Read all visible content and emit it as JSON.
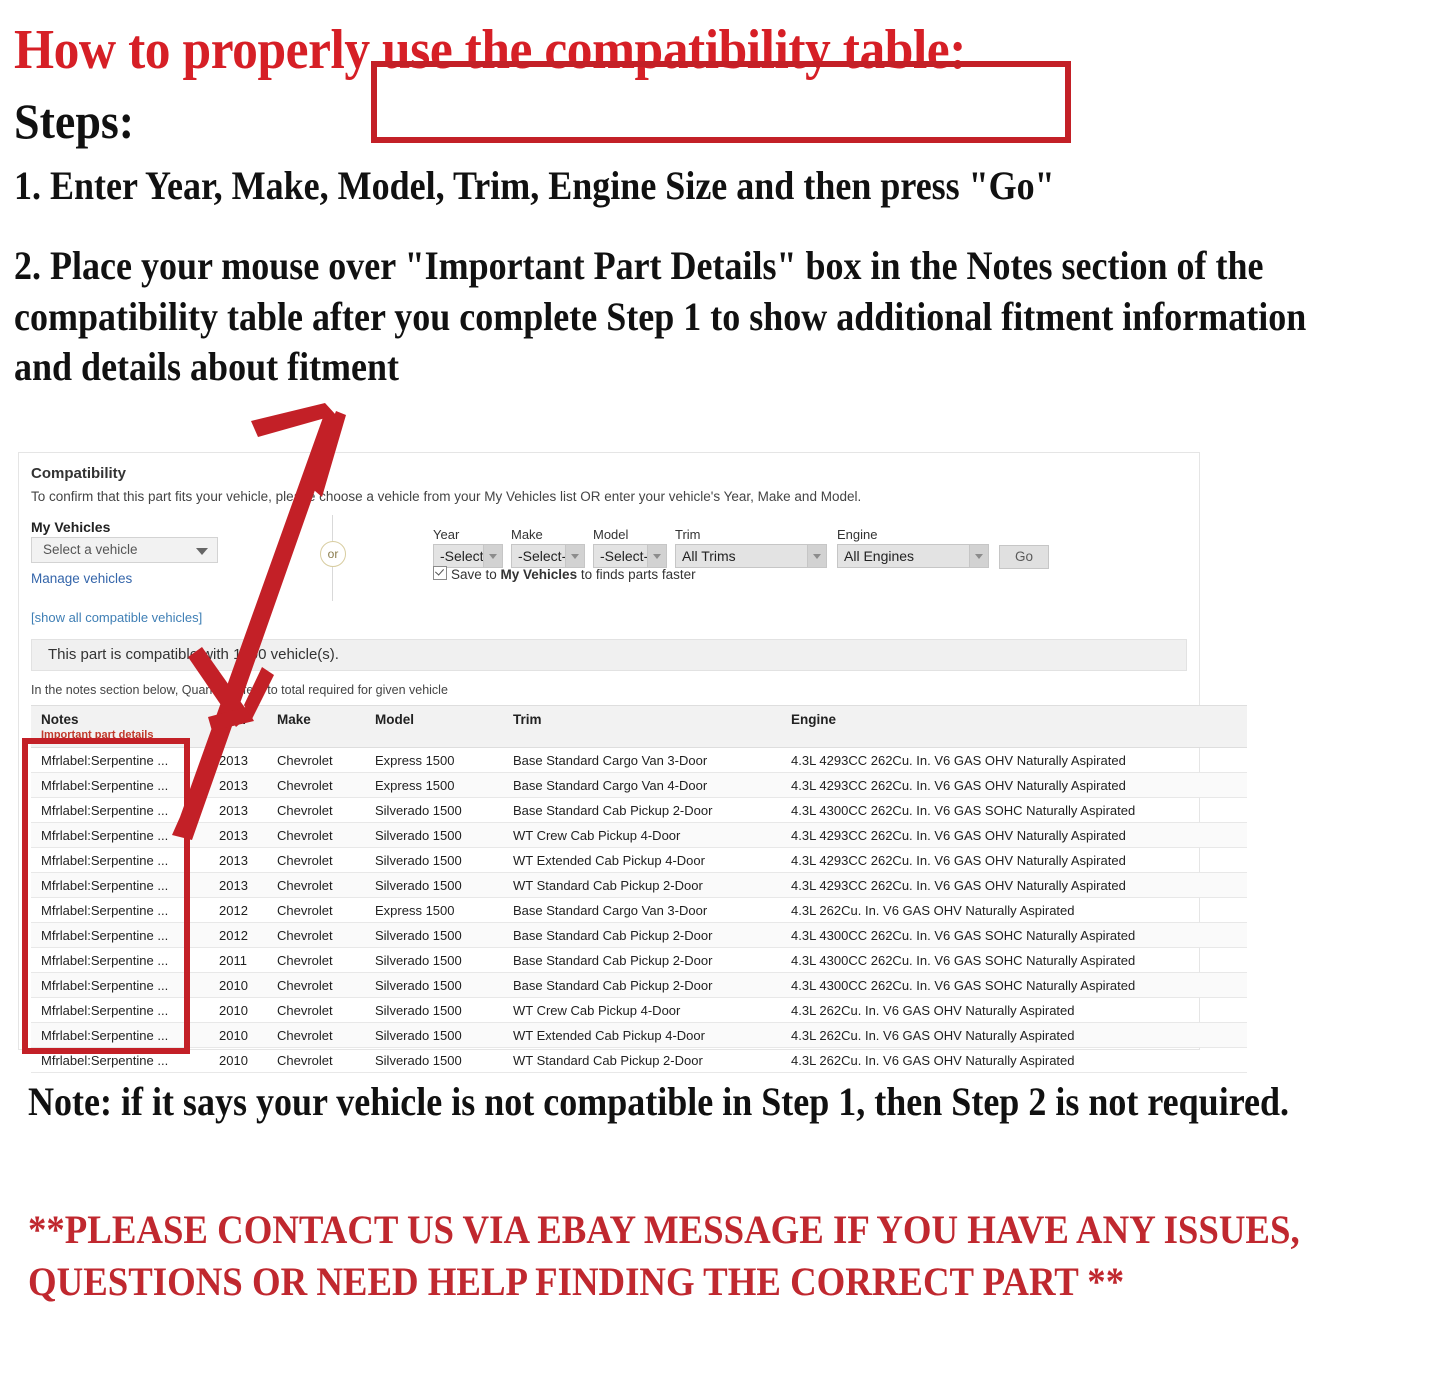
{
  "instructions": {
    "headline": "How to properly use the compatibility table:",
    "steps_label": "Steps:",
    "step1": "1. Enter Year, Make, Model, Trim, Engine Size and then press \"Go\"",
    "step2": "2. Place your mouse over \"Important Part Details\" box in the Notes section of the compatibility table after you complete Step 1 to show additional fitment information and details about fitment"
  },
  "widget": {
    "title": "Compatibility",
    "subtitle": "To confirm that this part fits your vehicle, please choose a vehicle from your My Vehicles list OR enter your vehicle's Year, Make and Model.",
    "my_vehicles_label": "My Vehicles",
    "vehicle_select_value": "Select a vehicle",
    "manage_vehicles_link": "Manage vehicles",
    "show_all_link": "[show all compatible vehicles]",
    "or_text": "or",
    "compat_banner": "This part is compatible with 1000 vehicle(s).",
    "qty_note": "In the notes section below, Quantity refers to total required for given vehicle",
    "form": {
      "year_label": "Year",
      "year_value": "-Select-",
      "make_label": "Make",
      "make_value": "-Select-",
      "model_label": "Model",
      "model_value": "-Select-",
      "trim_label": "Trim",
      "trim_value": "All Trims",
      "engine_label": "Engine",
      "engine_value": "All Engines",
      "go_label": "Go",
      "save_prefix": "Save to ",
      "save_bold": "My Vehicles",
      "save_suffix": " to finds parts faster"
    }
  },
  "table": {
    "headers": {
      "notes": "Notes",
      "notes_sub": "Important part details",
      "year": "Year",
      "make": "Make",
      "model": "Model",
      "trim": "Trim",
      "engine": "Engine"
    },
    "rows": [
      {
        "notes": "Mfrlabel:Serpentine ...",
        "year": "2013",
        "make": "Chevrolet",
        "model": "Express 1500",
        "trim": "Base Standard Cargo Van 3-Door",
        "engine": "4.3L 4293CC 262Cu. In. V6 GAS OHV Naturally Aspirated"
      },
      {
        "notes": "Mfrlabel:Serpentine ...",
        "year": "2013",
        "make": "Chevrolet",
        "model": "Express 1500",
        "trim": "Base Standard Cargo Van 4-Door",
        "engine": "4.3L 4293CC 262Cu. In. V6 GAS OHV Naturally Aspirated"
      },
      {
        "notes": "Mfrlabel:Serpentine ...",
        "year": "2013",
        "make": "Chevrolet",
        "model": "Silverado 1500",
        "trim": "Base Standard Cab Pickup 2-Door",
        "engine": "4.3L 4300CC 262Cu. In. V6 GAS SOHC Naturally Aspirated"
      },
      {
        "notes": "Mfrlabel:Serpentine ...",
        "year": "2013",
        "make": "Chevrolet",
        "model": "Silverado 1500",
        "trim": "WT Crew Cab Pickup 4-Door",
        "engine": "4.3L 4293CC 262Cu. In. V6 GAS OHV Naturally Aspirated"
      },
      {
        "notes": "Mfrlabel:Serpentine ...",
        "year": "2013",
        "make": "Chevrolet",
        "model": "Silverado 1500",
        "trim": "WT Extended Cab Pickup 4-Door",
        "engine": "4.3L 4293CC 262Cu. In. V6 GAS OHV Naturally Aspirated"
      },
      {
        "notes": "Mfrlabel:Serpentine ...",
        "year": "2013",
        "make": "Chevrolet",
        "model": "Silverado 1500",
        "trim": "WT Standard Cab Pickup 2-Door",
        "engine": "4.3L 4293CC 262Cu. In. V6 GAS OHV Naturally Aspirated"
      },
      {
        "notes": "Mfrlabel:Serpentine ...",
        "year": "2012",
        "make": "Chevrolet",
        "model": "Express 1500",
        "trim": "Base Standard Cargo Van 3-Door",
        "engine": "4.3L 262Cu. In. V6 GAS OHV Naturally Aspirated"
      },
      {
        "notes": "Mfrlabel:Serpentine ...",
        "year": "2012",
        "make": "Chevrolet",
        "model": "Silverado 1500",
        "trim": "Base Standard Cab Pickup 2-Door",
        "engine": "4.3L 4300CC 262Cu. In. V6 GAS SOHC Naturally Aspirated"
      },
      {
        "notes": "Mfrlabel:Serpentine ...",
        "year": "2011",
        "make": "Chevrolet",
        "model": "Silverado 1500",
        "trim": "Base Standard Cab Pickup 2-Door",
        "engine": "4.3L 4300CC 262Cu. In. V6 GAS SOHC Naturally Aspirated"
      },
      {
        "notes": "Mfrlabel:Serpentine ...",
        "year": "2010",
        "make": "Chevrolet",
        "model": "Silverado 1500",
        "trim": "Base Standard Cab Pickup 2-Door",
        "engine": "4.3L 4300CC 262Cu. In. V6 GAS SOHC Naturally Aspirated"
      },
      {
        "notes": "Mfrlabel:Serpentine ...",
        "year": "2010",
        "make": "Chevrolet",
        "model": "Silverado 1500",
        "trim": "WT Crew Cab Pickup 4-Door",
        "engine": "4.3L 262Cu. In. V6 GAS OHV Naturally Aspirated"
      },
      {
        "notes": "Mfrlabel:Serpentine ...",
        "year": "2010",
        "make": "Chevrolet",
        "model": "Silverado 1500",
        "trim": "WT Extended Cab Pickup 4-Door",
        "engine": "4.3L 262Cu. In. V6 GAS OHV Naturally Aspirated"
      },
      {
        "notes": "Mfrlabel:Serpentine ...",
        "year": "2010",
        "make": "Chevrolet",
        "model": "Silverado 1500",
        "trim": "WT Standard Cab Pickup 2-Door",
        "engine": "4.3L 262Cu. In. V6 GAS OHV Naturally Aspirated"
      }
    ]
  },
  "footer": {
    "note": "Note: if it says your vehicle is not compatible in Step 1, then Step 2 is not required.",
    "contact": "**PLEASE CONTACT US VIA EBAY MESSAGE IF YOU HAVE ANY ISSUES, QUESTIONS OR NEED HELP FINDING THE CORRECT PART **"
  },
  "colors": {
    "brand_red": "#d61f26",
    "highlight_red": "#c32027",
    "link_blue": "#3465aa"
  }
}
